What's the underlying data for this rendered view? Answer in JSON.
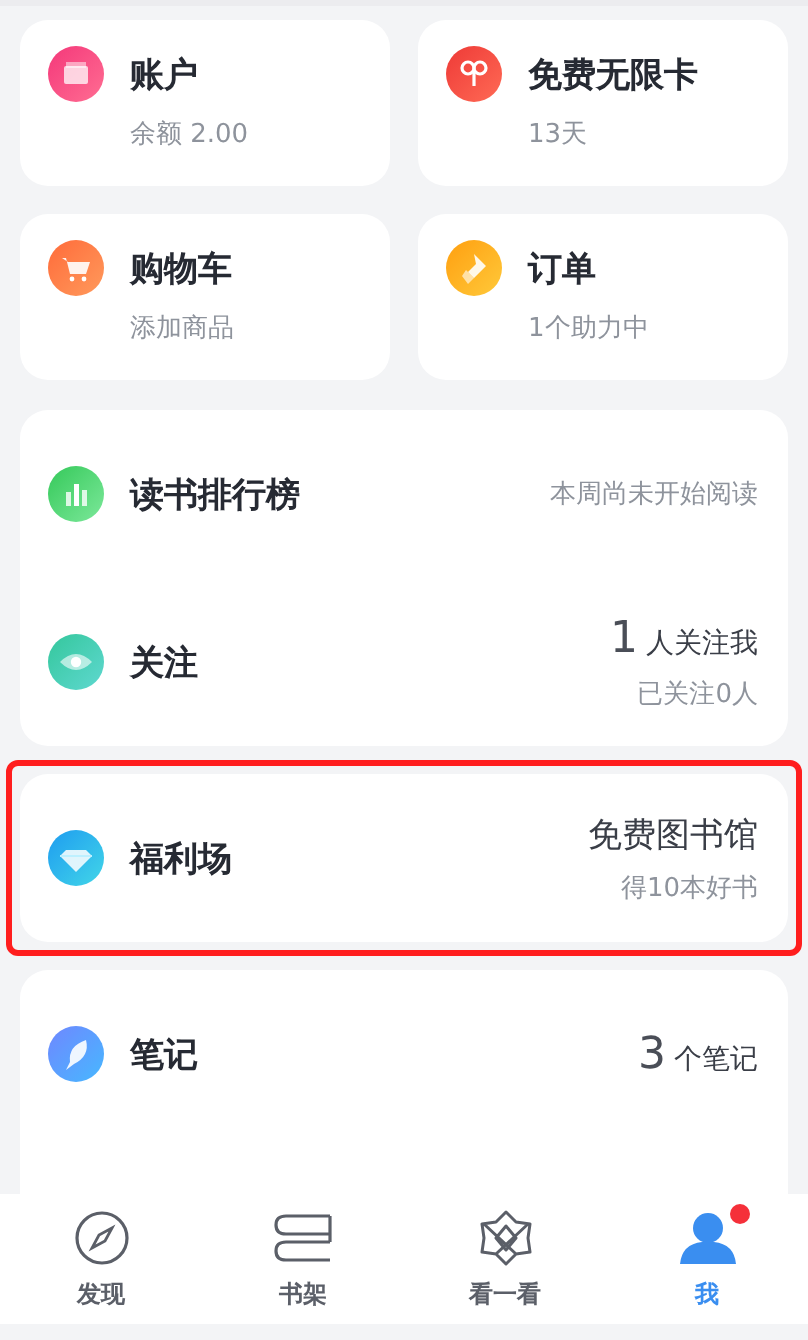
{
  "grid": [
    {
      "title": "账户",
      "subtitle": "余额 2.00"
    },
    {
      "title": "免费无限卡",
      "subtitle": "13天"
    },
    {
      "title": "购物车",
      "subtitle": "添加商品"
    },
    {
      "title": "订单",
      "subtitle": "1个助力中"
    }
  ],
  "lists": [
    {
      "highlighted": false,
      "rows": [
        {
          "title": "读书排行榜",
          "note": "本周尚未开始阅读"
        },
        {
          "title": "关注",
          "count": "1",
          "count_label": "人关注我",
          "note": "已关注0人"
        }
      ]
    },
    {
      "highlighted": true,
      "rows": [
        {
          "title": "福利场",
          "headline": "免费图书馆",
          "note": "得10本好书"
        }
      ]
    },
    {
      "highlighted": false,
      "rows": [
        {
          "title": "笔记",
          "count": "3",
          "count_label": "个笔记"
        }
      ]
    }
  ],
  "tabs": [
    {
      "label": "发现",
      "selected": false,
      "badge": false
    },
    {
      "label": "书架",
      "selected": false,
      "badge": false
    },
    {
      "label": "看一看",
      "selected": false,
      "badge": false
    },
    {
      "label": "我",
      "selected": true,
      "badge": true
    }
  ]
}
